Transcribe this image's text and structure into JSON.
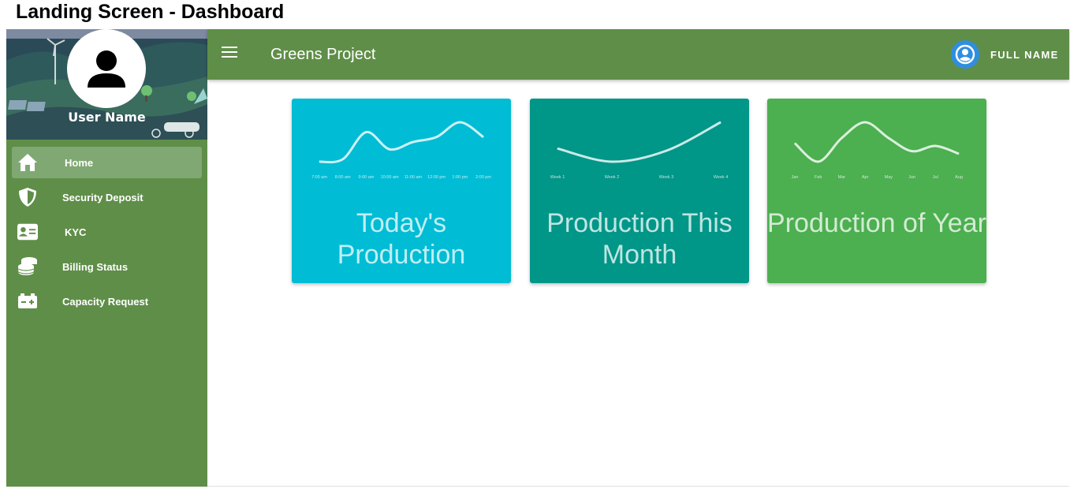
{
  "page": {
    "title": "Landing Screen - Dashboard"
  },
  "sidebar": {
    "user_name": "User Name",
    "items": [
      {
        "label": "Home",
        "icon": "home-icon",
        "active": true
      },
      {
        "label": "Security Deposit",
        "icon": "shield-icon",
        "active": false
      },
      {
        "label": "KYC",
        "icon": "id-card-icon",
        "active": false
      },
      {
        "label": "Billing Status",
        "icon": "coins-icon",
        "active": false
      },
      {
        "label": "Capacity Request",
        "icon": "battery-icon",
        "active": false
      }
    ]
  },
  "topbar": {
    "app_title": "Greens Project",
    "user_label": "FULL NAME"
  },
  "colors": {
    "sidebar": "#5f8e48",
    "topbar": "#5f8e48",
    "card_today": "#00bcd4",
    "card_month": "#009688",
    "card_year": "#4caf50",
    "account_icon": "#2f8ee0"
  },
  "cards": [
    {
      "title": "Today's Production",
      "chart_data": {
        "type": "line",
        "categories": [
          "7:00 am",
          "8:00 am",
          "9:00 am",
          "10:00 am",
          "11:00 am",
          "12:00 pm",
          "1:00 pm",
          "2:00 pm"
        ],
        "values": [
          2,
          3,
          14,
          7,
          10,
          12,
          18,
          12
        ]
      }
    },
    {
      "title": "Production This Month",
      "chart_data": {
        "type": "line",
        "categories": [
          "Week 1",
          "Week 2",
          "Week 3",
          "Week 4"
        ],
        "values": [
          8,
          2,
          7,
          20
        ]
      }
    },
    {
      "title": "Production of Year",
      "chart_data": {
        "type": "line",
        "categories": [
          "Jan",
          "Feb",
          "Mar",
          "Apr",
          "May",
          "Jun",
          "Jul",
          "Aug"
        ],
        "values": [
          10,
          3,
          12,
          18,
          12,
          7,
          9,
          6
        ]
      }
    }
  ]
}
